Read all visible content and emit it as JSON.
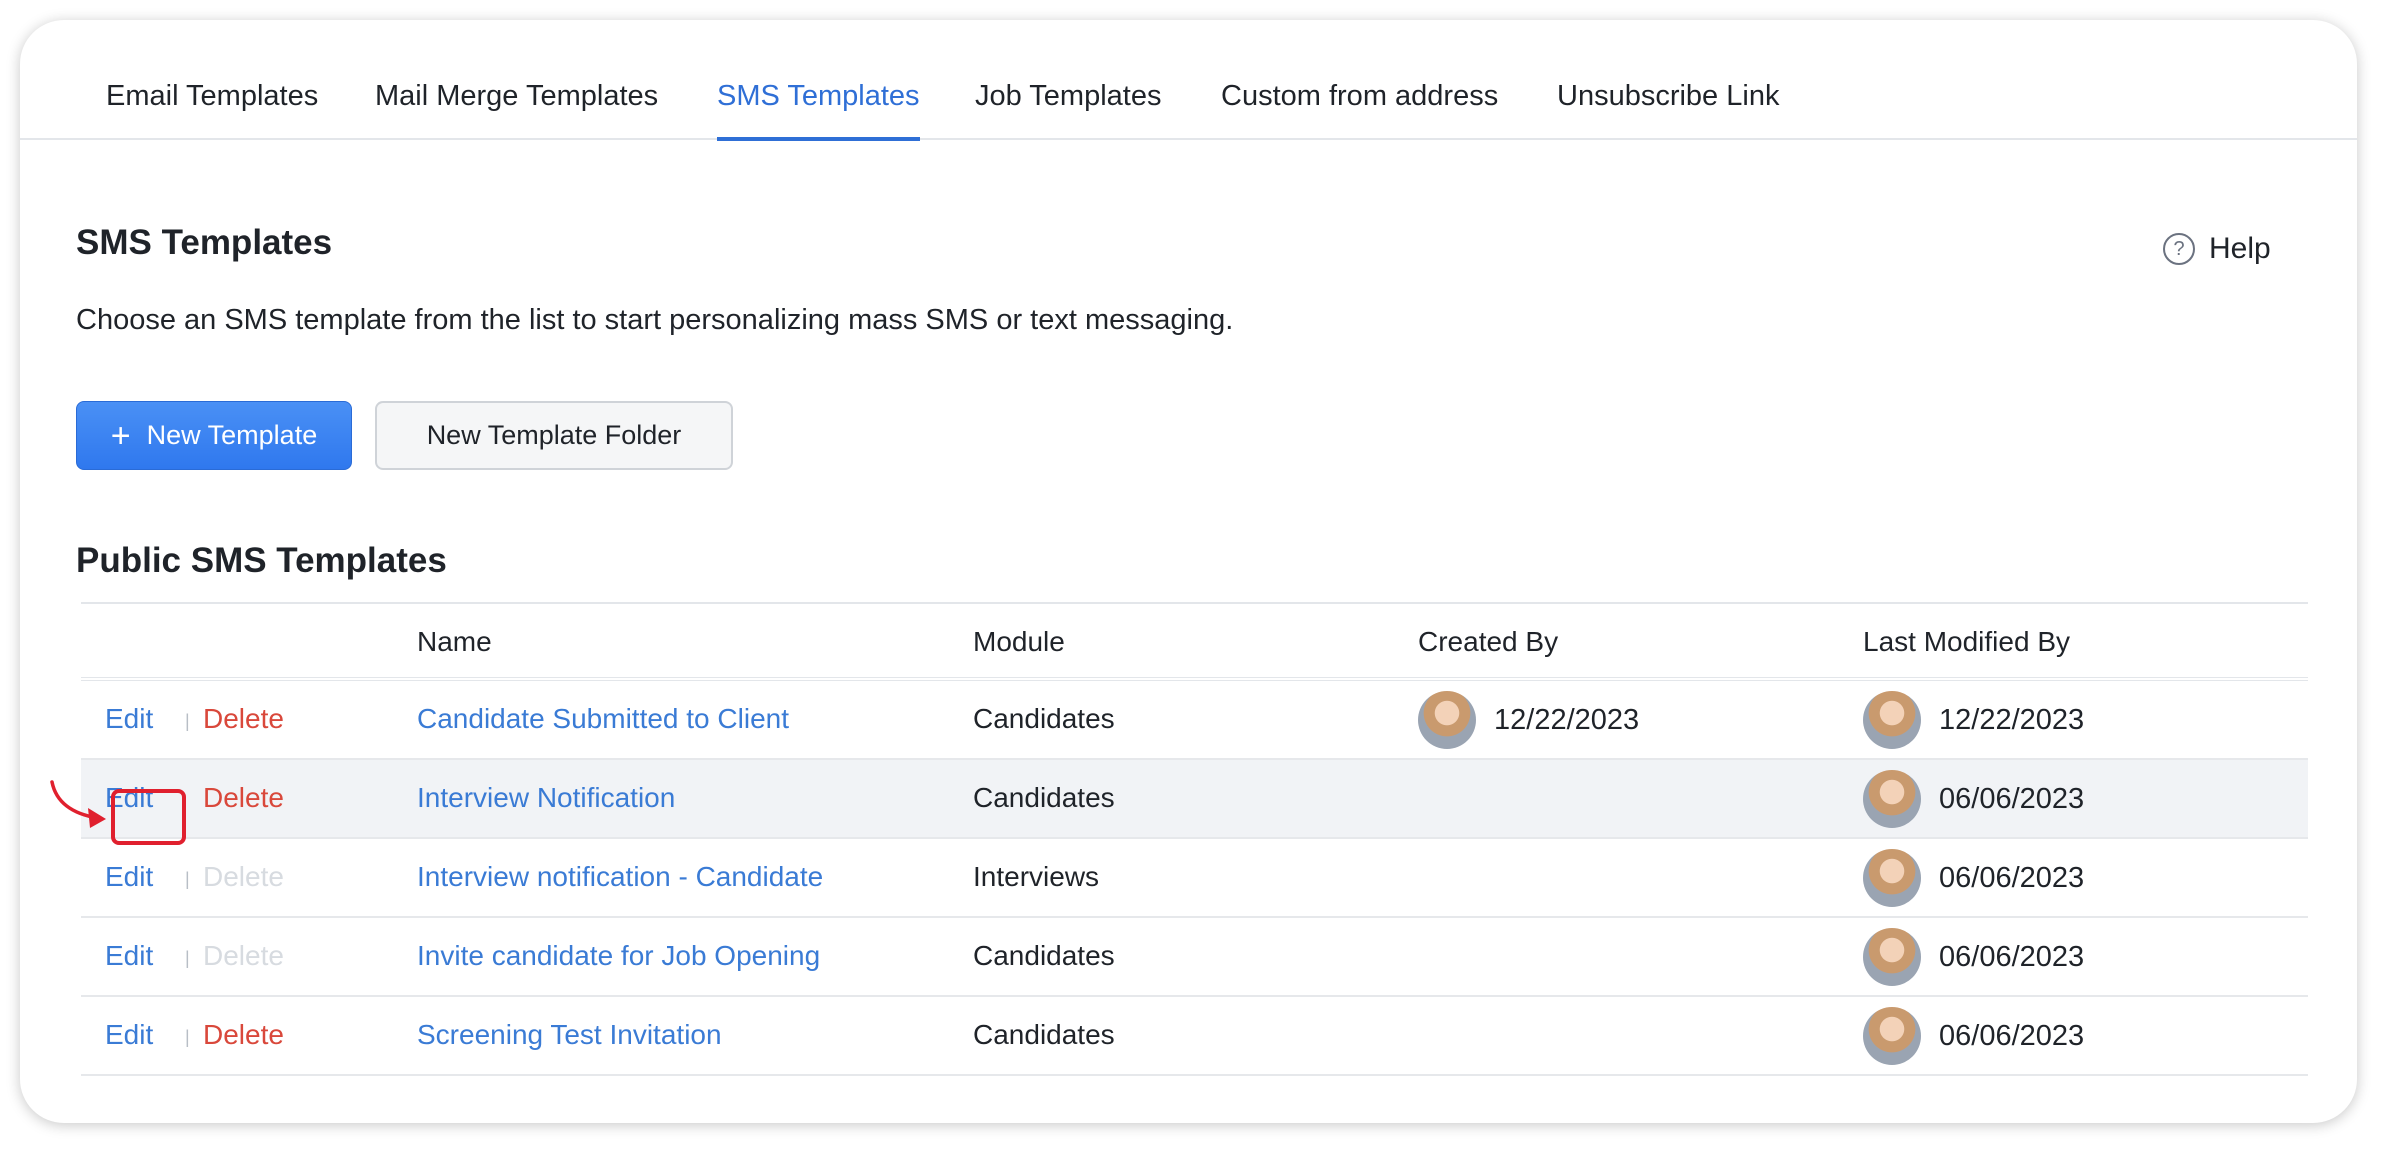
{
  "tabs": [
    {
      "label": "Email Templates",
      "active": false
    },
    {
      "label": "Mail Merge Templates",
      "active": false
    },
    {
      "label": "SMS Templates",
      "active": true
    },
    {
      "label": "Job Templates",
      "active": false
    },
    {
      "label": "Custom from address",
      "active": false
    },
    {
      "label": "Unsubscribe Link",
      "active": false
    }
  ],
  "header": {
    "title": "SMS Templates",
    "help_label": "Help",
    "help_icon": "question-circle-icon",
    "description": "Choose an SMS template from the list to start personalizing mass SMS or text messaging."
  },
  "actions": {
    "new_template_icon": "+",
    "new_template_label": "New Template",
    "new_folder_label": "New Template Folder"
  },
  "section": {
    "title": "Public SMS Templates"
  },
  "table": {
    "columns": [
      "Name",
      "Module",
      "Created By",
      "Last Modified By"
    ],
    "edit_label": "Edit",
    "delete_label": "Delete",
    "separator": "|",
    "rows": [
      {
        "name": "Candidate Submitted to Client",
        "module": "Candidates",
        "created_by": "12/22/2023",
        "last_modified": "12/22/2023",
        "delete_enabled": true
      },
      {
        "name": "Interview Notification",
        "module": "Candidates",
        "created_by": "",
        "last_modified": "06/06/2023",
        "delete_enabled": true
      },
      {
        "name": "Interview notification - Candidate",
        "module": "Interviews",
        "created_by": "",
        "last_modified": "06/06/2023",
        "delete_enabled": false
      },
      {
        "name": "Invite candidate for Job Opening",
        "module": "Candidates",
        "created_by": "",
        "last_modified": "06/06/2023",
        "delete_enabled": false
      },
      {
        "name": "Screening Test Invitation",
        "module": "Candidates",
        "created_by": "",
        "last_modified": "06/06/2023",
        "delete_enabled": true
      }
    ]
  },
  "colors": {
    "accent": "#2f6fd6",
    "link": "#3a7bd5",
    "delete": "#d9483b",
    "annotation": "#e0202e"
  }
}
